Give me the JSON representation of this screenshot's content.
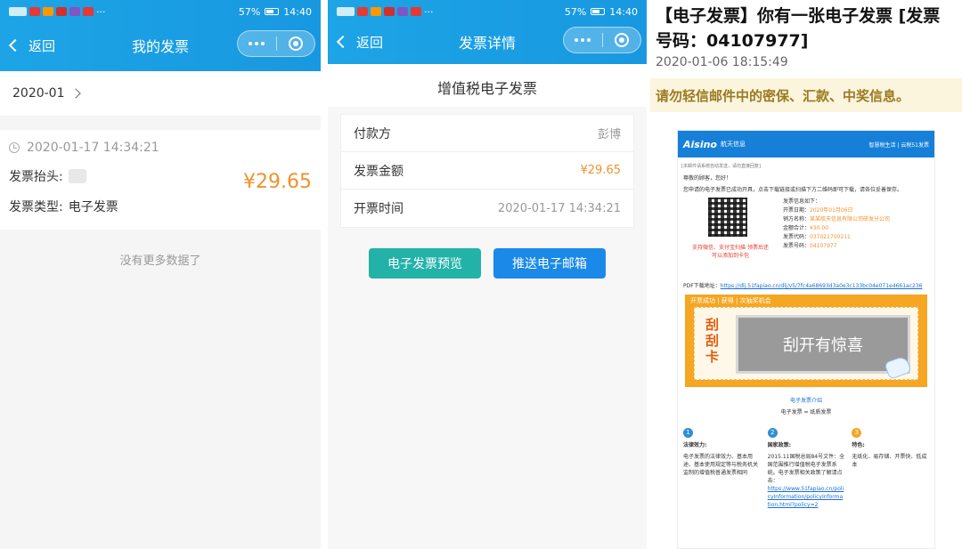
{
  "status": {
    "time": "14:40",
    "battery": "57%"
  },
  "phone1": {
    "back_label": "返回",
    "title": "我的发票",
    "month": "2020-01",
    "invoice": {
      "time": "2020-01-17 14:34:21",
      "header_label": "发票抬头:",
      "type_label": "发票类型:",
      "type_value": "电子发票",
      "amount": "¥29.65"
    },
    "no_more": "没有更多数据了"
  },
  "phone2": {
    "back_label": "返回",
    "title": "发票详情",
    "invoice_title": "增值税电子发票",
    "rows": [
      {
        "label": "付款方",
        "value": "彭博"
      },
      {
        "label": "发票金额",
        "value": "¥29.65"
      },
      {
        "label": "开票时间",
        "value": "2020-01-17 14:34:21"
      }
    ],
    "preview_button": "电子发票预览",
    "email_button": "推送电子邮箱"
  },
  "email": {
    "subject": "【电子发票】你有一张电子发票 [发票号码：04107977]",
    "date": "2020-01-06 18:15:49",
    "warning": "请勿轻信邮件中的密保、汇款、中奖信息。",
    "brand": "Aisino",
    "brand_cn": "航天信息",
    "header_right": "智慧税生活 | 云税51发票",
    "notice_small": "[本邮件请系统自动发送，请勿直接回复]",
    "greeting": "尊敬的顾客，您好！",
    "body_text": "您申请的电子发票已成功开具，点击下载链接或扫描下方二维码即可下载，请各位妥善保存。",
    "qr_caption": "支持微信、支付宝扫描 领票后还可以添加到卡包",
    "info_title": "发票信息如下：",
    "info_rows": [
      {
        "label": "开票日期：",
        "value": "2020年01月06日"
      },
      {
        "label": "销方名称：",
        "value": "某某航天信息有限公司研发分公司"
      },
      {
        "label": "金额合计：",
        "value": "¥30.00"
      },
      {
        "label": "发票代码：",
        "value": "037021700211"
      },
      {
        "label": "发票号码：",
        "value": "04107977"
      }
    ],
    "pdf_label": "PDF下载地址：",
    "pdf_link": "https://dlj.51fapiao.cn/dlj/v5/7fc4a68693d3a0e3c133bc04e071e4661ac236",
    "scratch_top": "开票成功 | 获得 | 次抽奖机会",
    "scratch_label": "刮刮卡",
    "scratch_text": "刮开有惊喜",
    "intro_link": "电子发票介绍",
    "intro_sub": "电子发票 = 纸质发票",
    "columns": [
      {
        "num": "1",
        "color": "#2f8fd6",
        "title": "法律效力:",
        "text": "电子发票的法律效力、基本用途、基本使用规定等与税务机关监制的增值税普通发票相同"
      },
      {
        "num": "2",
        "color": "#2f8fd6",
        "title": "国家政策:",
        "text": "2015.11国税总局84号文件：全国范围推行增值税电子发票系统。电子发票相关政策了解请点击：",
        "link": "https://www.51fapiao.cn/policyInformation/policyInformation.html?policy=2"
      },
      {
        "num": "3",
        "color": "#f5a623",
        "title": "特色:",
        "text": "无纸化、易存储、开票快、低成本"
      }
    ]
  }
}
